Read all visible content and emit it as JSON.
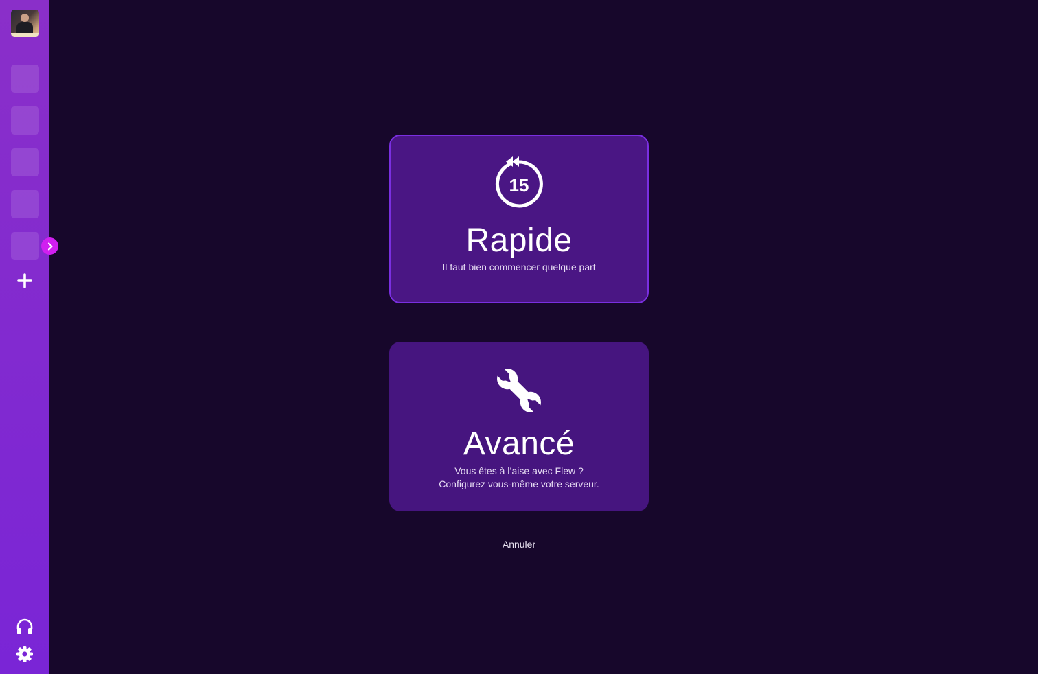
{
  "sidebar": {
    "avatar_alt": "user-avatar",
    "server_slots": 5,
    "icons": [
      "plus-icon",
      "chevron-right-icon",
      "headset-icon",
      "gear-icon"
    ]
  },
  "options": {
    "quick": {
      "icon": "replay-15-icon",
      "icon_text": "15",
      "title": "Rapide",
      "description": "Il faut bien commencer quelque part"
    },
    "advanced": {
      "icon": "wrench-icon",
      "title": "Avancé",
      "description_line1": "Vous êtes à l’aise avec Flew ?",
      "description_line2": "Configurez vous-même votre serveur."
    }
  },
  "cancel_label": "Annuler",
  "colors": {
    "background": "#17072b",
    "sidebar": "#8a2fc9",
    "card": "#46157f",
    "card_selected_border": "#7a2fe0",
    "accent": "#d11ff0"
  }
}
